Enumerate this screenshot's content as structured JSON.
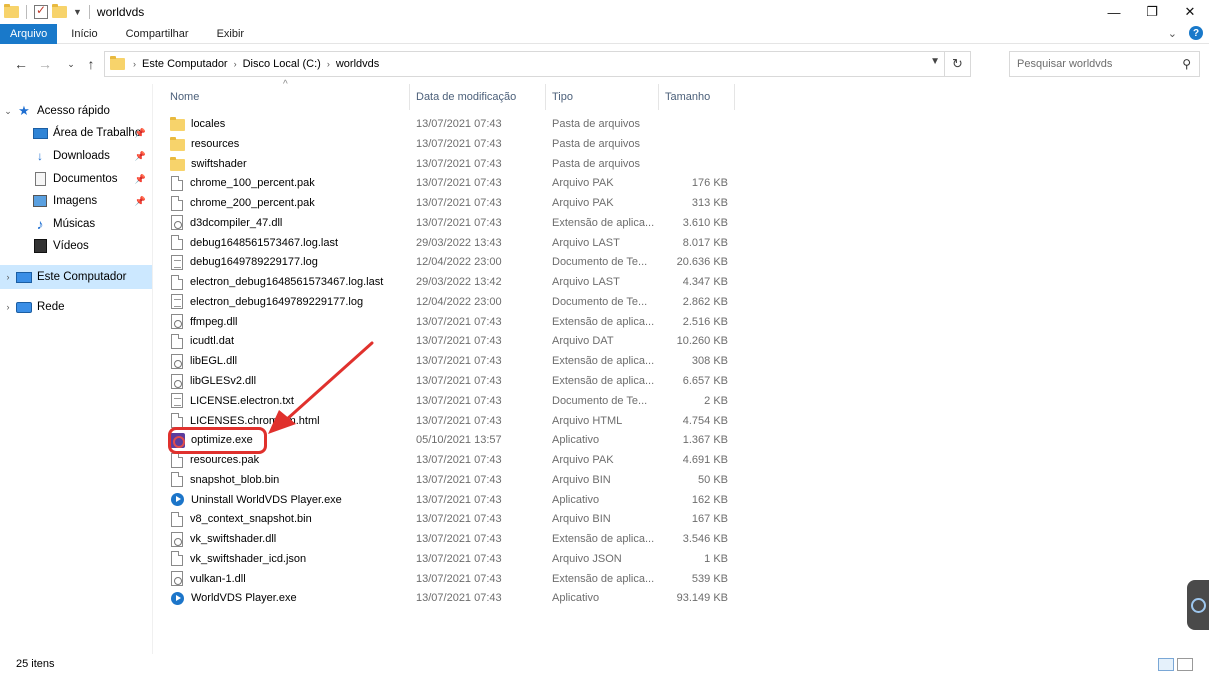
{
  "window": {
    "title": "worldvds",
    "controls": [
      "—",
      "❐",
      "✕"
    ]
  },
  "ribbon": {
    "tabs": [
      "Arquivo",
      "Início",
      "Compartilhar",
      "Exibir"
    ]
  },
  "address": {
    "crumbs": [
      "Este Computador",
      "Disco Local (C:)",
      "worldvds"
    ]
  },
  "search": {
    "placeholder": "Pesquisar worldvds"
  },
  "sidebar": {
    "items": [
      {
        "label": "Acesso rápido",
        "icon": "star-icon"
      },
      {
        "label": "Área de Trabalho",
        "icon": "desktop-icon"
      },
      {
        "label": "Downloads",
        "icon": "download-icon"
      },
      {
        "label": "Documentos",
        "icon": "documents-icon"
      },
      {
        "label": "Imagens",
        "icon": "pictures-icon"
      },
      {
        "label": "Músicas",
        "icon": "music-icon"
      },
      {
        "label": "Vídeos",
        "icon": "videos-icon"
      },
      {
        "label": "Este Computador",
        "icon": "computer-icon"
      },
      {
        "label": "Rede",
        "icon": "network-icon"
      }
    ]
  },
  "columns": {
    "name": "Nome",
    "date": "Data de modificação",
    "type": "Tipo",
    "size": "Tamanho"
  },
  "files": [
    {
      "name": "locales",
      "date": "13/07/2021 07:43",
      "type": "Pasta de arquivos",
      "size": "",
      "icon": "folder"
    },
    {
      "name": "resources",
      "date": "13/07/2021 07:43",
      "type": "Pasta de arquivos",
      "size": "",
      "icon": "folder"
    },
    {
      "name": "swiftshader",
      "date": "13/07/2021 07:43",
      "type": "Pasta de arquivos",
      "size": "",
      "icon": "folder"
    },
    {
      "name": "chrome_100_percent.pak",
      "date": "13/07/2021 07:43",
      "type": "Arquivo PAK",
      "size": "176 KB",
      "icon": "file"
    },
    {
      "name": "chrome_200_percent.pak",
      "date": "13/07/2021 07:43",
      "type": "Arquivo PAK",
      "size": "313 KB",
      "icon": "file"
    },
    {
      "name": "d3dcompiler_47.dll",
      "date": "13/07/2021 07:43",
      "type": "Extensão de aplica...",
      "size": "3.610 KB",
      "icon": "dll"
    },
    {
      "name": "debug1648561573467.log.last",
      "date": "29/03/2022 13:43",
      "type": "Arquivo LAST",
      "size": "8.017 KB",
      "icon": "file"
    },
    {
      "name": "debug1649789229177.log",
      "date": "12/04/2022 23:00",
      "type": "Documento de Te...",
      "size": "20.636 KB",
      "icon": "txt"
    },
    {
      "name": "electron_debug1648561573467.log.last",
      "date": "29/03/2022 13:42",
      "type": "Arquivo LAST",
      "size": "4.347 KB",
      "icon": "file"
    },
    {
      "name": "electron_debug1649789229177.log",
      "date": "12/04/2022 23:00",
      "type": "Documento de Te...",
      "size": "2.862 KB",
      "icon": "txt"
    },
    {
      "name": "ffmpeg.dll",
      "date": "13/07/2021 07:43",
      "type": "Extensão de aplica...",
      "size": "2.516 KB",
      "icon": "dll"
    },
    {
      "name": "icudtl.dat",
      "date": "13/07/2021 07:43",
      "type": "Arquivo DAT",
      "size": "10.260 KB",
      "icon": "file"
    },
    {
      "name": "libEGL.dll",
      "date": "13/07/2021 07:43",
      "type": "Extensão de aplica...",
      "size": "308 KB",
      "icon": "dll"
    },
    {
      "name": "libGLESv2.dll",
      "date": "13/07/2021 07:43",
      "type": "Extensão de aplica...",
      "size": "6.657 KB",
      "icon": "dll"
    },
    {
      "name": "LICENSE.electron.txt",
      "date": "13/07/2021 07:43",
      "type": "Documento de Te...",
      "size": "2 KB",
      "icon": "txt"
    },
    {
      "name": "LICENSES.chromium.html",
      "date": "13/07/2021 07:43",
      "type": "Arquivo HTML",
      "size": "4.754 KB",
      "icon": "file"
    },
    {
      "name": "optimize.exe",
      "date": "05/10/2021 13:57",
      "type": "Aplicativo",
      "size": "1.367 KB",
      "icon": "app-opt"
    },
    {
      "name": "resources.pak",
      "date": "13/07/2021 07:43",
      "type": "Arquivo PAK",
      "size": "4.691 KB",
      "icon": "file"
    },
    {
      "name": "snapshot_blob.bin",
      "date": "13/07/2021 07:43",
      "type": "Arquivo BIN",
      "size": "50 KB",
      "icon": "file"
    },
    {
      "name": "Uninstall WorldVDS Player.exe",
      "date": "13/07/2021 07:43",
      "type": "Aplicativo",
      "size": "162 KB",
      "icon": "app-blue"
    },
    {
      "name": "v8_context_snapshot.bin",
      "date": "13/07/2021 07:43",
      "type": "Arquivo BIN",
      "size": "167 KB",
      "icon": "file"
    },
    {
      "name": "vk_swiftshader.dll",
      "date": "13/07/2021 07:43",
      "type": "Extensão de aplica...",
      "size": "3.546 KB",
      "icon": "dll"
    },
    {
      "name": "vk_swiftshader_icd.json",
      "date": "13/07/2021 07:43",
      "type": "Arquivo JSON",
      "size": "1 KB",
      "icon": "file"
    },
    {
      "name": "vulkan-1.dll",
      "date": "13/07/2021 07:43",
      "type": "Extensão de aplica...",
      "size": "539 KB",
      "icon": "dll"
    },
    {
      "name": "WorldVDS Player.exe",
      "date": "13/07/2021 07:43",
      "type": "Aplicativo",
      "size": "93.149 KB",
      "icon": "app-blue"
    }
  ],
  "status": {
    "count": "25 itens"
  },
  "colors": {
    "accent": "#1979ca",
    "selection": "#cce8ff",
    "annotation": "#e0312d"
  }
}
